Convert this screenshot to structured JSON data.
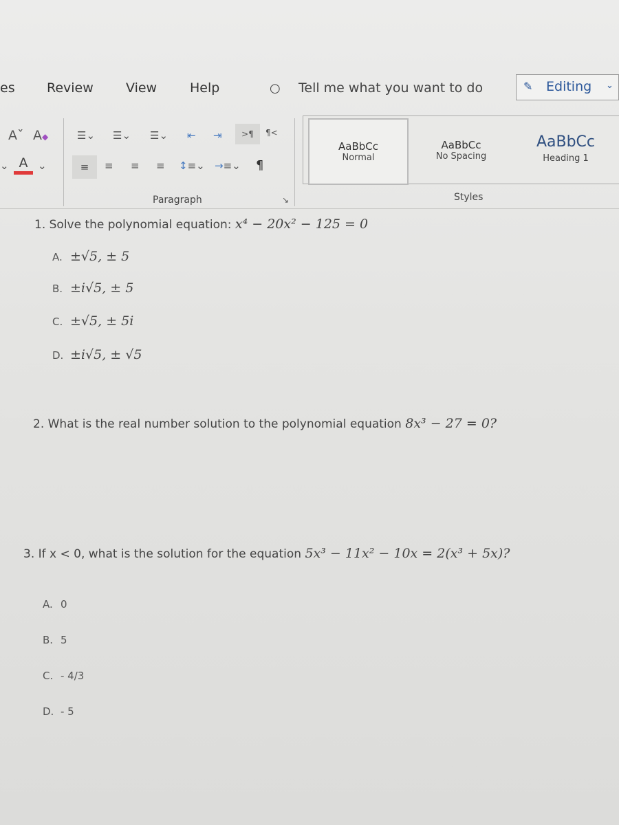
{
  "ribbon_tabs": {
    "partial": "es",
    "review": "Review",
    "view": "View",
    "help": "Help",
    "tell_me": "Tell me what you want to do",
    "editing": "Editing"
  },
  "paragraph_group": {
    "label": "Paragraph"
  },
  "styles_group": {
    "label": "Styles",
    "items": [
      {
        "sample": "AaBbCc",
        "name": "Normal"
      },
      {
        "sample": "AaBbCc",
        "name": "No Spacing"
      },
      {
        "sample": "AaBbCc",
        "name": "Heading 1"
      }
    ]
  },
  "colors": {
    "font_color_bar": "#e03a3a",
    "accent": "#2b579a"
  },
  "questions": [
    {
      "text": "1. Solve the polynomial equation:",
      "equation": "x⁴ − 20x² − 125 = 0",
      "options": [
        {
          "label": "A.",
          "value": "±√5, ± 5"
        },
        {
          "label": "B.",
          "value": "±i√5, ± 5"
        },
        {
          "label": "C.",
          "value": "±√5, ± 5i"
        },
        {
          "label": "D.",
          "value": "±i√5, ± √5"
        }
      ]
    },
    {
      "text": "2. What is the real number solution to the polynomial equation",
      "equation": "8x³ − 27 = 0?"
    },
    {
      "text": "3. If x < 0, what is the solution for the equation",
      "equation": "5x³ − 11x² − 10x = 2(x³ + 5x)?",
      "options": [
        {
          "label": "A.",
          "value": "0"
        },
        {
          "label": "B.",
          "value": "5"
        },
        {
          "label": "C.",
          "value": "- 4/3"
        },
        {
          "label": "D.",
          "value": "- 5"
        }
      ]
    }
  ]
}
